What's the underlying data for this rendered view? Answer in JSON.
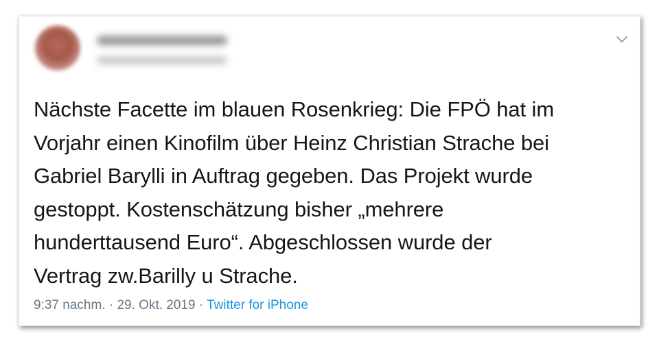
{
  "tweet": {
    "text": "Nächste Facette im blauen Rosenkrieg: Die FPÖ hat im\nVorjahr einen Kinofilm über Heinz Christian Strache bei\nGabriel Barylli in Auftrag gegeben. Das Projekt wurde\ngestoppt. Kostenschätzung bisher „mehrere\nhunderttausend Euro“. Abgeschlossen wurde der\nVertrag zw.Barilly u Strache.",
    "time": "9:37 nachm.",
    "separator": "·",
    "date": "29. Okt. 2019",
    "source": "Twitter for iPhone"
  },
  "icons": {
    "menu": "chevron-down-icon"
  },
  "colors": {
    "text": "#14171a",
    "meta": "#657786",
    "link": "#1b95e0"
  }
}
